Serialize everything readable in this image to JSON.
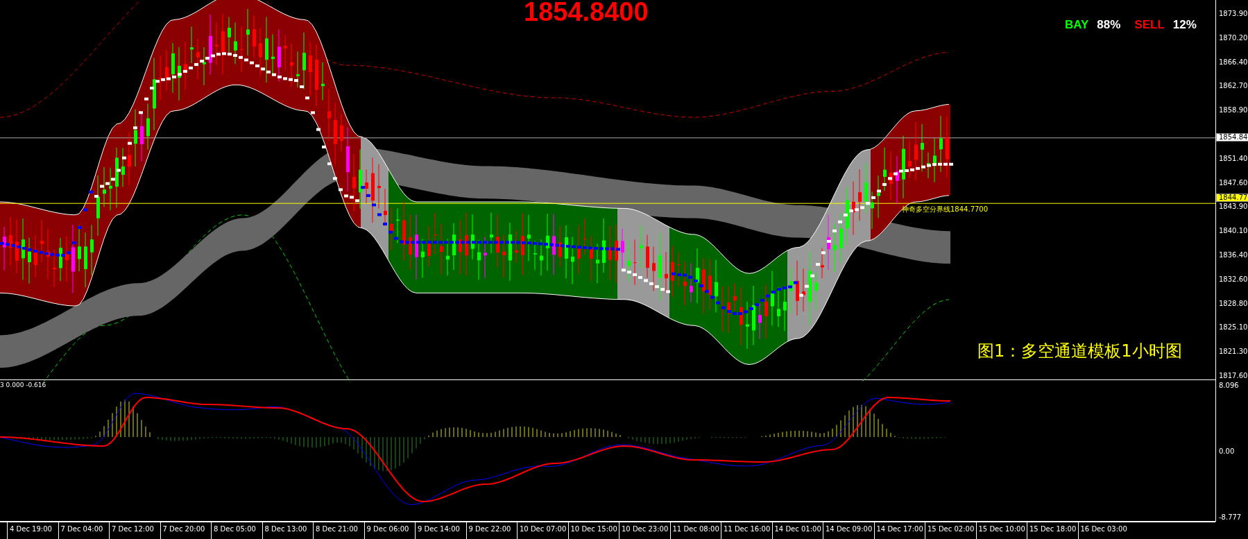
{
  "price_title": "1854.8400",
  "sentiment": [
    {
      "label": "BAY",
      "value": "88%",
      "color": "#00ff00"
    },
    {
      "label": "SELL",
      "value": "12%",
      "color": "#ff0000"
    }
  ],
  "price_axis": [
    "1873.90",
    "1870.20",
    "1866.40",
    "1862.70",
    "1858.90",
    "1851.40",
    "1847.60",
    "1843.90",
    "1840.10",
    "1836.40",
    "1832.60",
    "1828.80",
    "1825.10",
    "1821.30",
    "1817.60"
  ],
  "current_price_marker": "1854.84",
  "boundary_marker": "1844.77",
  "boundary_label": "神奇多空分界线1844.7700",
  "caption": "图1：多空通道模板1小时图",
  "indicator_label": "3 0.000 -0.616",
  "oscillator_axis": [
    "8.096",
    "0.00",
    "-8.777"
  ],
  "time_axis": [
    "4 Dec 19:00",
    "7 Dec 04:00",
    "7 Dec 12:00",
    "7 Dec 20:00",
    "8 Dec 05:00",
    "8 Dec 13:00",
    "8 Dec 21:00",
    "9 Dec 06:00",
    "9 Dec 14:00",
    "9 Dec 22:00",
    "10 Dec 07:00",
    "10 Dec 15:00",
    "10 Dec 23:00",
    "11 Dec 08:00",
    "11 Dec 16:00",
    "14 Dec 01:00",
    "14 Dec 09:00",
    "14 Dec 17:00",
    "15 Dec 02:00",
    "15 Dec 10:00",
    "15 Dec 18:00",
    "16 Dec 03:00"
  ]
}
